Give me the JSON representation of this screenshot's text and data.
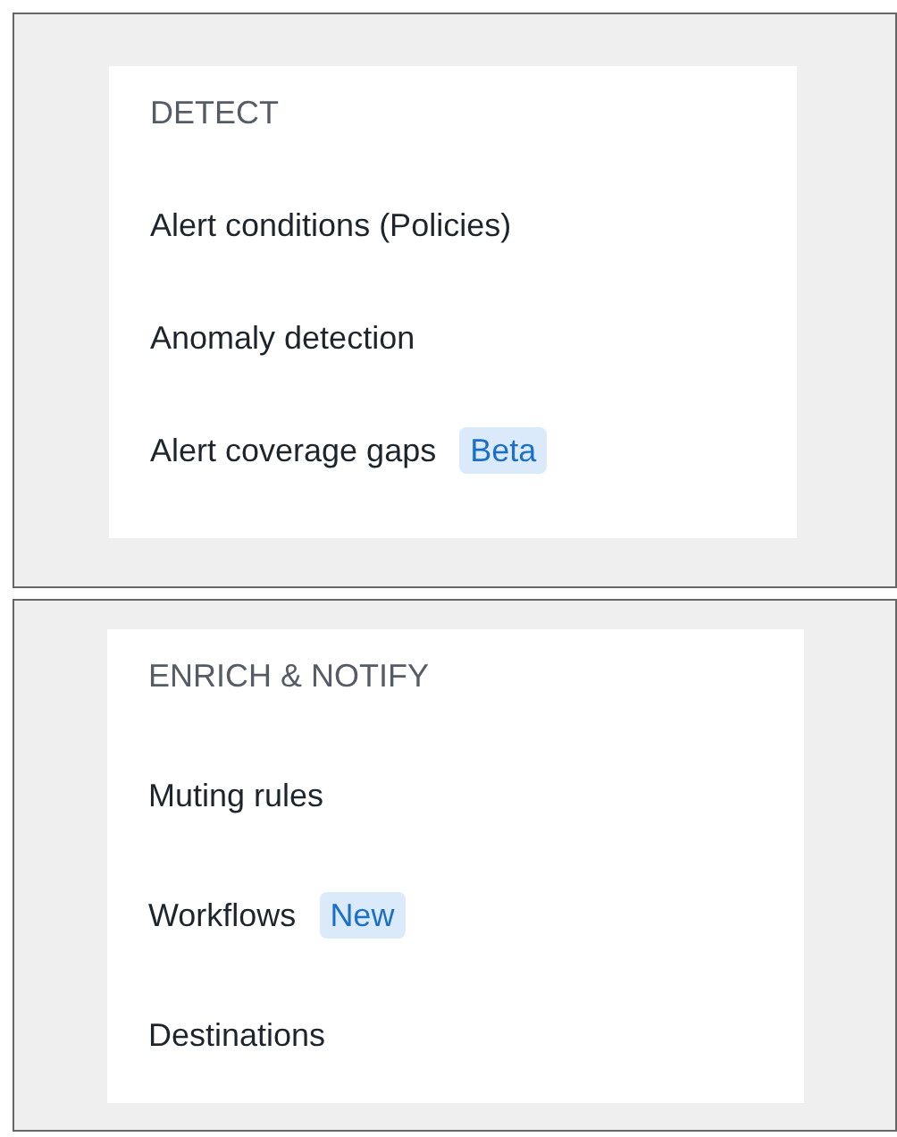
{
  "sections": [
    {
      "title": "DETECT",
      "items": [
        {
          "label": "Alert conditions (Policies)"
        },
        {
          "label": "Anomaly detection"
        },
        {
          "label": "Alert coverage gaps",
          "badge": "Beta"
        }
      ]
    },
    {
      "title": "ENRICH & NOTIFY",
      "items": [
        {
          "label": "Muting rules"
        },
        {
          "label": "Workflows",
          "badge": "New"
        },
        {
          "label": "Destinations"
        }
      ]
    }
  ]
}
